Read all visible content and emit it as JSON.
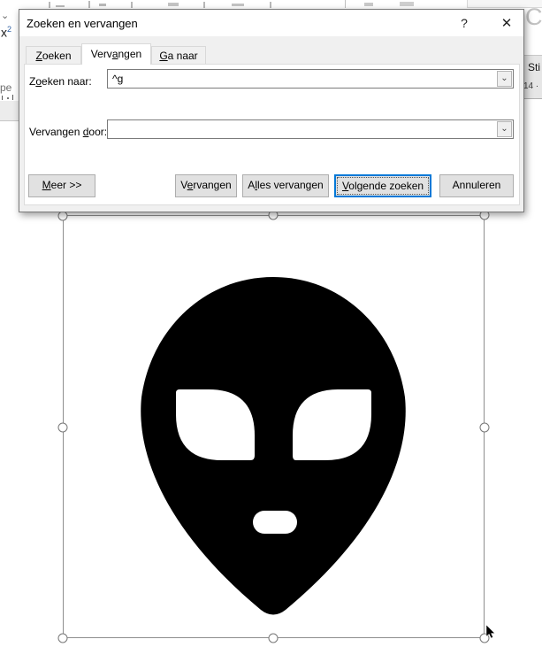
{
  "dialog": {
    "title": "Zoeken en vervangen",
    "help_icon": "?",
    "close_icon": "✕",
    "accent_focus": "#0078d7",
    "tabs": [
      {
        "pre": "",
        "key": "Z",
        "post": "oeken"
      },
      {
        "pre": "Verv",
        "key": "a",
        "post": "ngen"
      },
      {
        "pre": "",
        "key": "G",
        "post": "a naar"
      }
    ],
    "active_tab": "Vervangen",
    "fields": [
      {
        "label": {
          "pre": "Z",
          "key": "o",
          "post": "eken naar:"
        },
        "value": "^g"
      },
      {
        "label": {
          "pre": "Vervangen ",
          "key": "d",
          "post": "oor:"
        },
        "value": ""
      }
    ],
    "combo_chevron": "⌄",
    "buttons": {
      "more": {
        "pre": "",
        "key": "M",
        "post": "eer >>"
      },
      "replace": {
        "pre": "V",
        "key": "e",
        "post": "rvangen"
      },
      "replace_all": {
        "pre": "A",
        "key": "l",
        "post": "les vervangen"
      },
      "find_next": {
        "pre": "",
        "key": "V",
        "post": "olgende zoeken"
      },
      "cancel": {
        "pre": "Annuleren",
        "key": "",
        "post": ""
      }
    }
  },
  "background_fragments": {
    "combo_chevron": "⌄",
    "superscript_button": {
      "base": "x",
      "sup": "2"
    },
    "group_label": "pe",
    "heading": "Co",
    "styles_pane": "Sti",
    "ruler_number": "14 ·"
  },
  "picture": {
    "description": "alien-head-clipart",
    "fill": "#000000",
    "handle_count": 8
  }
}
